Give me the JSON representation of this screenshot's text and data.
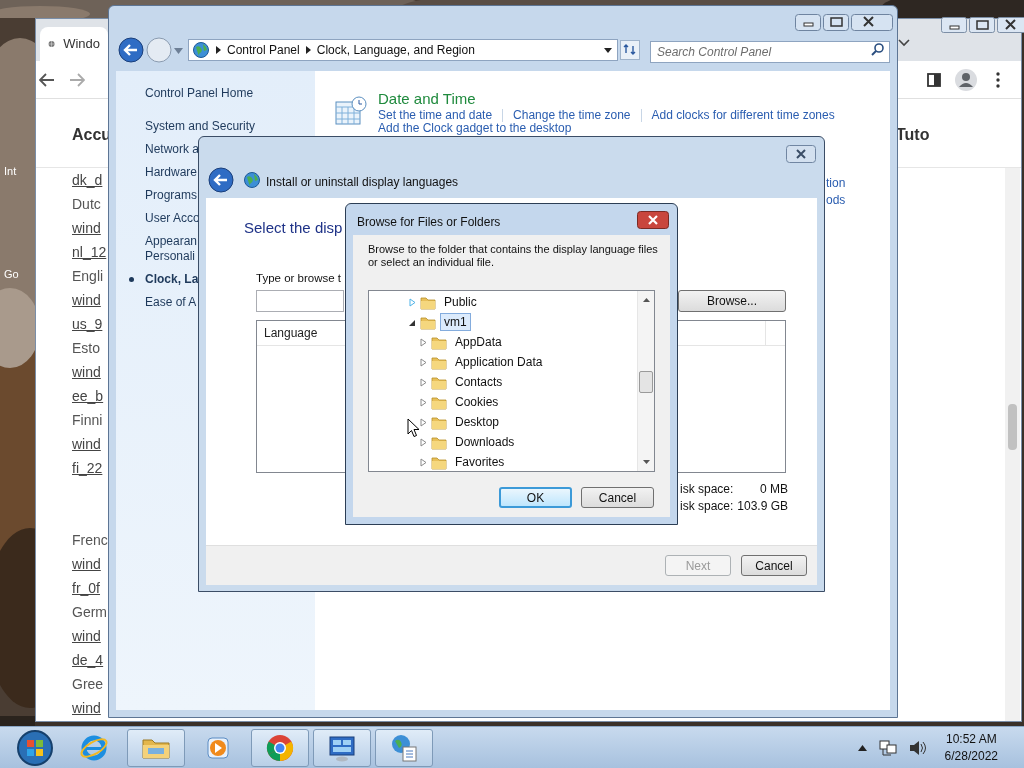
{
  "desktop": {
    "icon_labels": [
      "Int",
      "Go"
    ]
  },
  "browser": {
    "tab_title": "Windo",
    "header": [
      "Accu",
      "Tuto"
    ],
    "link_groups": [
      [
        {
          "text": "dk_d",
          "kind": "link"
        },
        {
          "text": "Dutc",
          "kind": "text"
        },
        {
          "text": "wind",
          "kind": "link"
        },
        {
          "text": "nl_12",
          "kind": "link"
        },
        {
          "text": "Engli",
          "kind": "text"
        },
        {
          "text": "wind",
          "kind": "link"
        },
        {
          "text": "us_9",
          "kind": "link"
        },
        {
          "text": "Esto",
          "kind": "text"
        },
        {
          "text": "wind",
          "kind": "link"
        },
        {
          "text": "ee_b",
          "kind": "link"
        },
        {
          "text": "Finni",
          "kind": "text"
        },
        {
          "text": "wind",
          "kind": "link"
        },
        {
          "text": "fi_22",
          "kind": "link"
        }
      ],
      [
        {
          "text": "Frenc",
          "kind": "text"
        },
        {
          "text": "wind",
          "kind": "link"
        },
        {
          "text": "fr_0f",
          "kind": "link"
        },
        {
          "text": "Germ",
          "kind": "text"
        },
        {
          "text": "wind",
          "kind": "link"
        },
        {
          "text": "de_4",
          "kind": "link"
        },
        {
          "text": "Gree",
          "kind": "text"
        },
        {
          "text": "wind",
          "kind": "link"
        }
      ]
    ]
  },
  "control_panel": {
    "address": [
      "Control Panel",
      "Clock, Language, and Region"
    ],
    "search": {
      "placeholder": "Search Control Panel"
    },
    "sidebar": {
      "home": "Control Panel Home",
      "items": [
        {
          "label": "System and Security",
          "selected": false
        },
        {
          "label": "Network a",
          "selected": false
        },
        {
          "label": "Hardware",
          "selected": false
        },
        {
          "label": "Programs",
          "selected": false
        },
        {
          "label": "User Acco",
          "selected": false
        },
        {
          "label": "Appearan\nPersonali",
          "selected": false
        },
        {
          "label": "Clock, La",
          "selected": true
        },
        {
          "label": "Ease of A",
          "selected": false
        }
      ]
    },
    "date_and_time": {
      "title": "Date and Time",
      "links": [
        "Set the time and date",
        "Change the time zone",
        "Add clocks for different time zones",
        "Add the Clock gadget to the desktop"
      ]
    },
    "partial_links": [
      "tion",
      "ods"
    ]
  },
  "install_dialog": {
    "title": "Install or uninstall display languages",
    "heading": "Select the disp",
    "field_label": "Type or browse t",
    "browse_button": "Browse...",
    "table": {
      "columns": [
        "Language"
      ]
    },
    "space": [
      {
        "label": "isk space:",
        "value": "0 MB"
      },
      {
        "label": "isk space:",
        "value": "103.9 GB"
      }
    ],
    "buttons": [
      {
        "label": "Next",
        "disabled": true
      },
      {
        "label": "Cancel",
        "disabled": false
      }
    ]
  },
  "browse_dialog": {
    "title": "Browse for Files or Folders",
    "description": "Browse to the folder that contains the display language files\nor select an individual file.",
    "tree": [
      {
        "label": "Public",
        "expanded": false,
        "selected": false
      },
      {
        "label": "vm1",
        "expanded": true,
        "selected": true,
        "children": [
          {
            "label": "AppData",
            "expanded": false,
            "selected": false
          },
          {
            "label": "Application Data",
            "expanded": false,
            "selected": false
          },
          {
            "label": "Contacts",
            "expanded": false,
            "selected": false
          },
          {
            "label": "Cookies",
            "expanded": false,
            "selected": false
          },
          {
            "label": "Desktop",
            "expanded": false,
            "selected": false
          },
          {
            "label": "Downloads",
            "expanded": false,
            "selected": false
          },
          {
            "label": "Favorites",
            "expanded": false,
            "selected": false
          }
        ]
      }
    ],
    "buttons": [
      {
        "label": "OK",
        "default": true
      },
      {
        "label": "Cancel",
        "default": false
      }
    ]
  },
  "taskbar": {
    "items": [
      {
        "kind": "ie",
        "running": false
      },
      {
        "kind": "explorer",
        "running": true
      },
      {
        "kind": "media",
        "running": false
      },
      {
        "kind": "chrome",
        "running": true
      },
      {
        "kind": "control-panel",
        "running": true
      },
      {
        "kind": "language",
        "running": true
      }
    ],
    "clock": {
      "time": "10:52 AM",
      "date": "6/28/2022"
    }
  }
}
